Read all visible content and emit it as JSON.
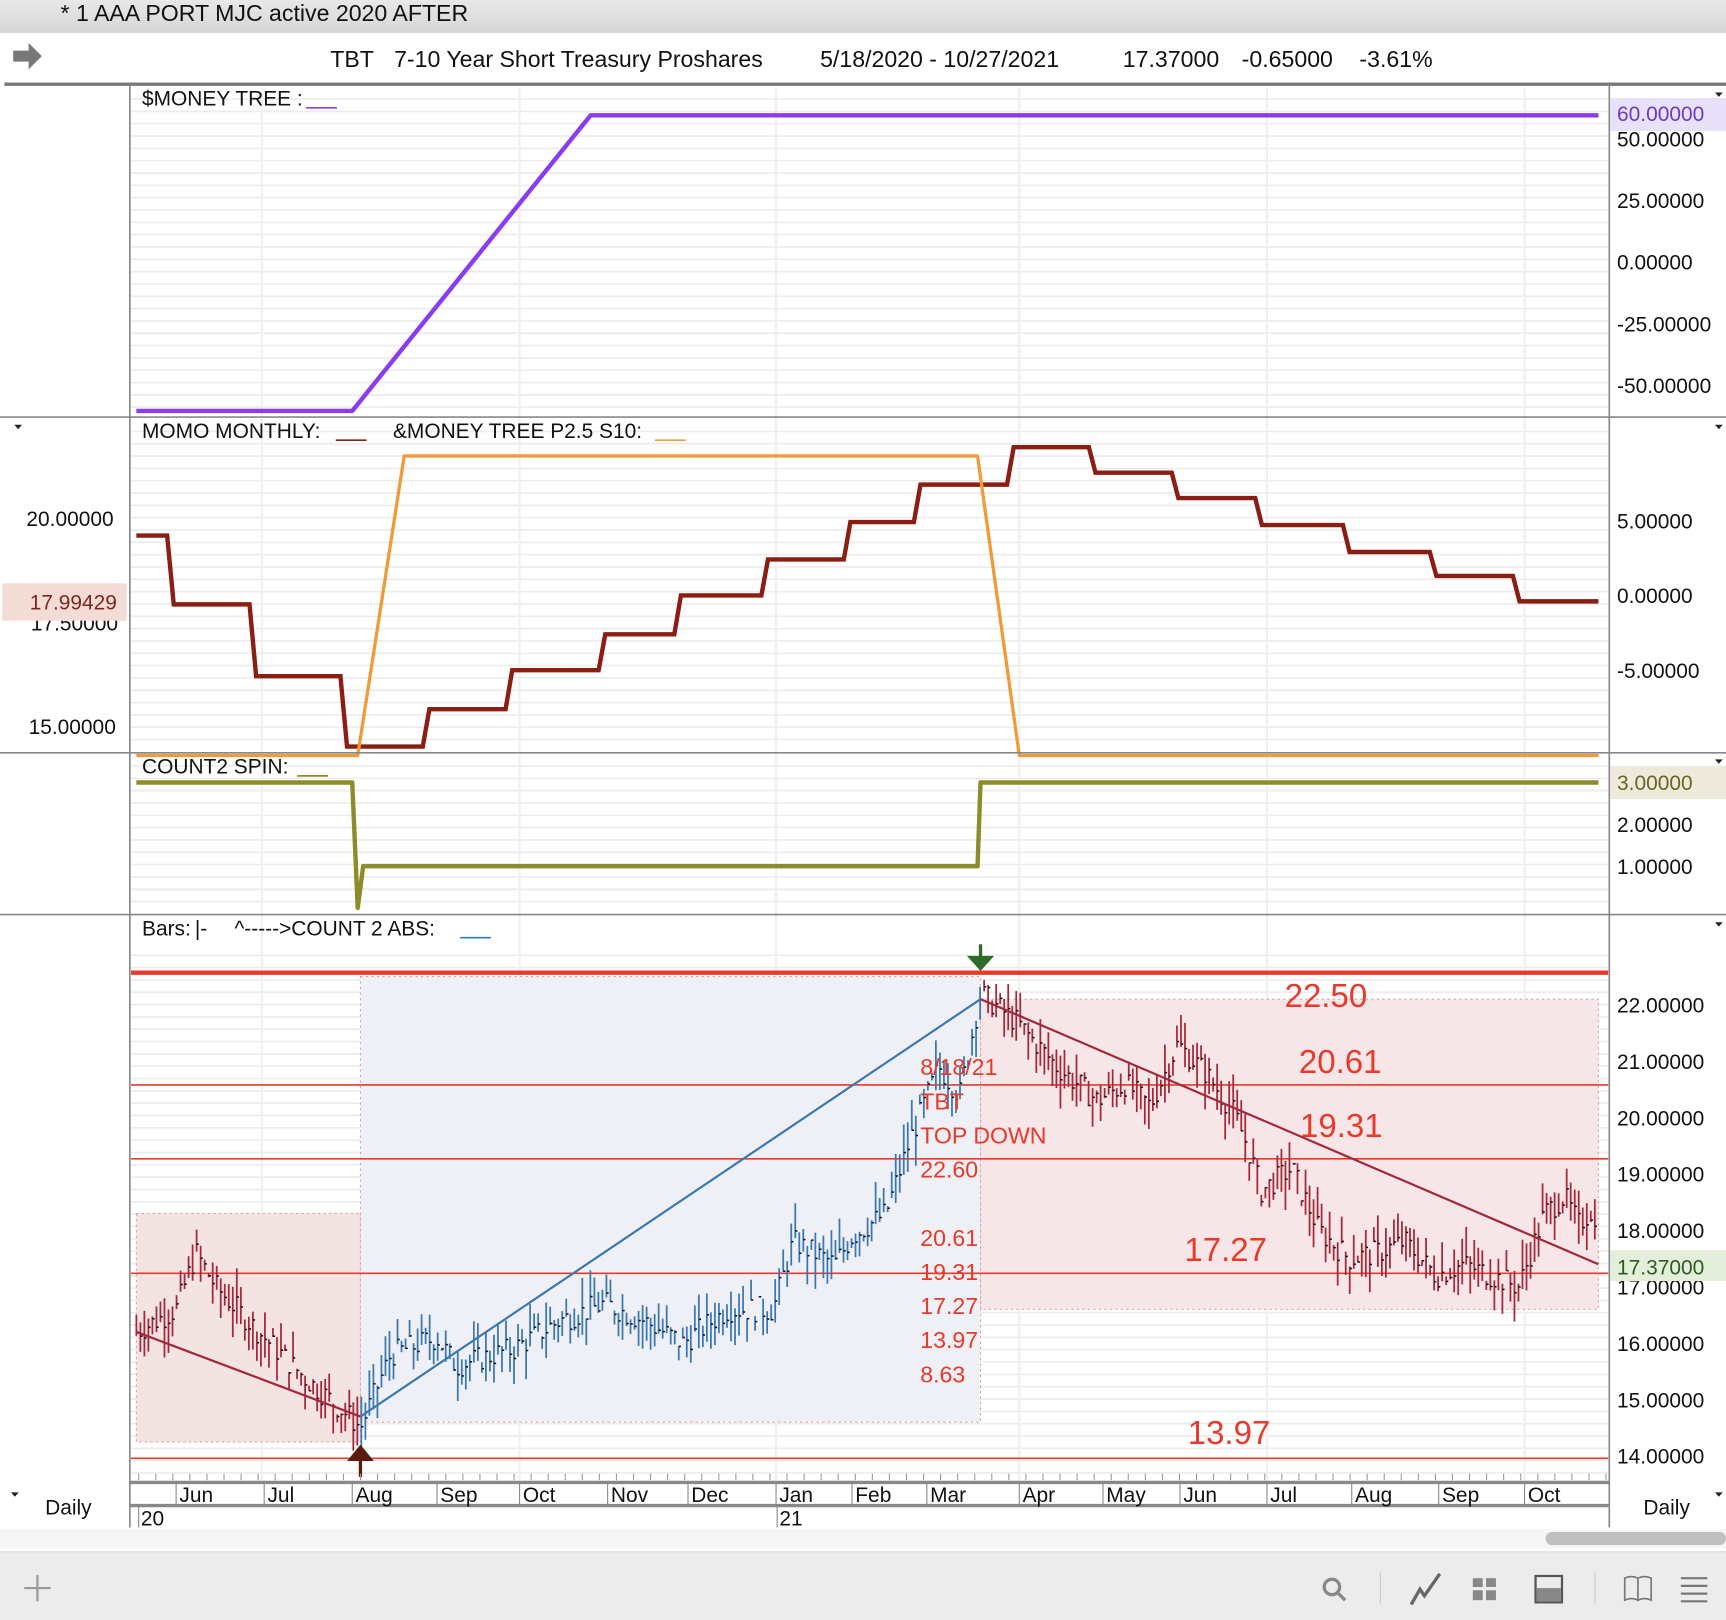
{
  "window": {
    "title": "* 1 AAA PORT MJC active 2020 AFTER"
  },
  "header": {
    "symbol": "TBT",
    "name": "7-10 Year Short Treasury Proshares",
    "date_range": "5/18/2020 - 10/27/2021",
    "last": "17.37000",
    "change": "-0.65000",
    "change_pct": "-3.61%"
  },
  "panes": {
    "money_tree": {
      "label": "$MONEY TREE :",
      "current": "60.00000",
      "axis": [
        "50.00000",
        "25.00000",
        "0.00000",
        "-25.00000",
        "-50.00000"
      ],
      "color": "#8a3df0"
    },
    "momo": {
      "label1": "MOMO MONTHLY:",
      "label2": "&MONEY TREE P2.5 S10:",
      "left_axis": [
        "20.00000",
        "17.50000",
        "15.00000"
      ],
      "left_current": "17.99429",
      "right_axis": [
        "5.00000",
        "0.00000",
        "-5.00000"
      ],
      "color1": "#8b1e12",
      "color2": "#f19a3a"
    },
    "count2": {
      "label": "COUNT2 SPIN:",
      "current": "3.00000",
      "axis": [
        "2.00000",
        "1.00000"
      ],
      "color": "#8c8c2a"
    },
    "price": {
      "label": "Bars:",
      "bars_glyph": "|-",
      "label2": "^----->COUNT 2 ABS:",
      "axis": [
        "22.00000",
        "21.00000",
        "20.00000",
        "19.00000",
        "18.00000",
        "17.00000",
        "16.00000",
        "15.00000",
        "14.00000"
      ],
      "current": "17.37000",
      "levels": [
        "22.50",
        "20.61",
        "19.31",
        "17.27",
        "13.97"
      ],
      "annotation": [
        "8/18/21",
        "TBT",
        "TOP DOWN",
        "22.60",
        "20.61",
        "19.31",
        "17.27",
        "13.97",
        "8.63"
      ]
    }
  },
  "date_axis": {
    "months": [
      "Jun",
      "Jul",
      "Aug",
      "Sep",
      "Oct",
      "Nov",
      "Dec",
      "Jan",
      "Feb",
      "Mar",
      "Apr",
      "May",
      "Jun",
      "Jul",
      "Aug",
      "Sep",
      "Oct"
    ],
    "years": [
      "20",
      "21"
    ],
    "period_left": "Daily",
    "period_right": "Daily"
  },
  "toolbar": {
    "icons": [
      "add-icon",
      "search-icon",
      "chart-line-icon",
      "grid-icon",
      "panel-icon",
      "book-icon",
      "menu-icon"
    ]
  },
  "chart_data": [
    {
      "type": "line",
      "title": "$MONEY TREE",
      "ylim": [
        -60,
        60
      ],
      "points": [
        [
          "2020-05-18",
          -61
        ],
        [
          "2020-08-01",
          -61
        ],
        [
          "2020-10-26",
          60
        ],
        [
          "2021-10-27",
          60
        ]
      ]
    },
    {
      "type": "line",
      "title": "MOMO MONTHLY",
      "axis": "right",
      "ylim": [
        -10,
        10
      ],
      "steps": [
        [
          "2020-05-18",
          4.0
        ],
        [
          "2020-05-30",
          -0.6
        ],
        [
          "2020-06-28",
          -5.4
        ],
        [
          "2020-07-29",
          -10.1
        ],
        [
          "2020-08-28",
          -7.6
        ],
        [
          "2020-09-28",
          -5.0
        ],
        [
          "2020-10-30",
          -2.6
        ],
        [
          "2020-11-28",
          0.0
        ],
        [
          "2020-12-28",
          2.4
        ],
        [
          "2021-01-30",
          4.9
        ],
        [
          "2021-02-28",
          7.4
        ],
        [
          "2021-03-29",
          9.9
        ],
        [
          "2021-04-28",
          8.2
        ],
        [
          "2021-05-30",
          6.5
        ],
        [
          "2021-06-29",
          4.7
        ],
        [
          "2021-07-30",
          2.9
        ],
        [
          "2021-08-30",
          1.3
        ],
        [
          "2021-09-29",
          -0.4
        ]
      ],
      "end": "2021-10-27"
    },
    {
      "type": "line",
      "title": "&MONEY TREE P2.5 S10",
      "axis": "left",
      "ylim": [
        14,
        22
      ],
      "points": [
        [
          "2020-05-18",
          14.3
        ],
        [
          "2020-08-03",
          14.3
        ],
        [
          "2020-08-20",
          21.5
        ],
        [
          "2021-03-18",
          21.5
        ],
        [
          "2021-04-01",
          14.3
        ],
        [
          "2021-10-27",
          14.3
        ]
      ]
    },
    {
      "type": "line",
      "title": "COUNT2 SPIN",
      "ylim": [
        0,
        3
      ],
      "points": [
        [
          "2020-05-18",
          3
        ],
        [
          "2020-08-01",
          3
        ],
        [
          "2020-08-03",
          0
        ],
        [
          "2020-08-05",
          1
        ],
        [
          "2021-03-18",
          1
        ],
        [
          "2021-03-19",
          3
        ],
        [
          "2021-10-27",
          3
        ]
      ]
    },
    {
      "type": "bar",
      "title": "TBT daily bars",
      "ylim": [
        14,
        22.5
      ],
      "path": [
        [
          "2020-05-18",
          16.2
        ],
        [
          "2020-06-01",
          16.6
        ],
        [
          "2020-06-08",
          17.6
        ],
        [
          "2020-06-15",
          17.0
        ],
        [
          "2020-06-30",
          16.2
        ],
        [
          "2020-07-15",
          15.4
        ],
        [
          "2020-07-31",
          14.7
        ],
        [
          "2020-08-04",
          14.5
        ],
        [
          "2020-08-15",
          15.8
        ],
        [
          "2020-09-01",
          16.1
        ],
        [
          "2020-09-08",
          15.6
        ],
        [
          "2020-09-30",
          15.9
        ],
        [
          "2020-10-15",
          16.4
        ],
        [
          "2020-10-31",
          16.7
        ],
        [
          "2020-11-15",
          16.4
        ],
        [
          "2020-11-30",
          16.0
        ],
        [
          "2020-12-15",
          16.6
        ],
        [
          "2020-12-31",
          16.6
        ],
        [
          "2021-01-08",
          17.8
        ],
        [
          "2021-01-25",
          17.4
        ],
        [
          "2021-02-01",
          17.9
        ],
        [
          "2021-02-15",
          18.3
        ],
        [
          "2021-02-25",
          19.6
        ],
        [
          "2021-03-05",
          20.9
        ],
        [
          "2021-03-12",
          20.4
        ],
        [
          "2021-03-19",
          22.2
        ],
        [
          "2021-03-31",
          21.7
        ],
        [
          "2021-04-15",
          20.9
        ],
        [
          "2021-04-30",
          20.3
        ],
        [
          "2021-05-10",
          20.6
        ],
        [
          "2021-05-20",
          20.2
        ],
        [
          "2021-05-31",
          21.3
        ],
        [
          "2021-06-10",
          20.8
        ],
        [
          "2021-06-20",
          20.1
        ],
        [
          "2021-06-25",
          19.5
        ],
        [
          "2021-06-30",
          18.7
        ],
        [
          "2021-07-10",
          19.1
        ],
        [
          "2021-07-20",
          18.0
        ],
        [
          "2021-07-31",
          17.5
        ],
        [
          "2021-08-10",
          17.6
        ],
        [
          "2021-08-20",
          17.8
        ],
        [
          "2021-08-31",
          17.2
        ],
        [
          "2021-09-10",
          17.4
        ],
        [
          "2021-09-20",
          17.2
        ],
        [
          "2021-09-30",
          17.0
        ],
        [
          "2021-10-08",
          18.3
        ],
        [
          "2021-10-15",
          18.6
        ],
        [
          "2021-10-20",
          18.1
        ],
        [
          "2021-10-25",
          18.4
        ],
        [
          "2021-10-27",
          17.37
        ]
      ],
      "up_phase": [
        "2020-08-04",
        "2021-03-19"
      ],
      "trendlines": [
        [
          [
            "2020-05-18",
            16.2
          ],
          [
            "2020-08-04",
            14.7
          ]
        ],
        [
          [
            "2020-08-04",
            14.7
          ],
          [
            "2021-03-19",
            22.1
          ]
        ],
        [
          [
            "2021-03-19",
            22.1
          ],
          [
            "2021-10-27",
            17.4
          ]
        ]
      ],
      "boxes": [
        {
          "from": "2020-05-18",
          "to": "2020-08-04",
          "low": 14.25,
          "high": 18.3,
          "color": "#f3e3e3"
        },
        {
          "from": "2020-08-04",
          "to": "2021-03-19",
          "low": 14.6,
          "high": 22.5,
          "color": "#eef0f6"
        },
        {
          "from": "2021-03-19",
          "to": "2021-10-27",
          "low": 16.6,
          "high": 22.1,
          "color": "#f6e6e7"
        }
      ],
      "hlines": [
        22.57,
        20.58,
        19.27,
        17.24,
        13.96
      ],
      "arrows": [
        {
          "date": "2021-03-19",
          "dir": "down",
          "color": "#2e6b2a"
        },
        {
          "date": "2020-08-04",
          "dir": "up",
          "color": "#5a1a0e"
        }
      ]
    }
  ]
}
